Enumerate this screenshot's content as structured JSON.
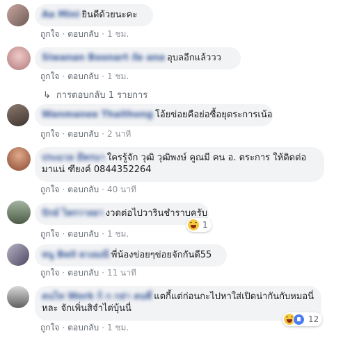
{
  "labels": {
    "like": "ถูกใจ",
    "reply": "ตอบกลับ",
    "dot": "·"
  },
  "comments": [
    {
      "name": "Aa Mini",
      "text": "ยินดีด้วยนะคะ",
      "time": "1 ชม."
    },
    {
      "name": "Siwanan Boonart ถัด ana",
      "text": "อุบลอีกแล้ววว",
      "time": "1 ชม.",
      "replies_label": "การตอบกลับ 1 รายการ"
    },
    {
      "name": "Wanmanee Thaithong",
      "text": "โอ้ยข่อยคือย่อซื้อยุตระการเน้อ",
      "time": "2 นาที"
    },
    {
      "name": "ประมวล มีพรนา",
      "text": "ใครรู้จัก วุฒิ วุฒิพงษ์ คูณมี คน อ. ตระการ ให้ติดต่อมาแน่ ฑียงค์ 0844352264",
      "time": "40 นาที"
    },
    {
      "name": "ปักษ์ ไพรวาลยา",
      "text": "งวดต่อไปวารินชำราบครับ",
      "time": "1 ชม.",
      "reaction_count": "1"
    },
    {
      "name": "หนู Bell ดวงมณี",
      "text": "พี่น้องข่อยๆข่อยจักกันดี55",
      "time": "11 นาที"
    },
    {
      "name": "คนไท Work ก็ ก กล่า คนพี่",
      "text": "แตกี้แต่ก่อนกะไปหาใส่เปิดน่ากันกับหมอนี่หละ จักเพิ่นสิจำได่บุ้นนี่",
      "time": "1 ชม.",
      "reaction_count": "12"
    }
  ],
  "colors": {
    "name": "#385898",
    "bubble": "#f2f3f5",
    "meta": "#90949c"
  }
}
